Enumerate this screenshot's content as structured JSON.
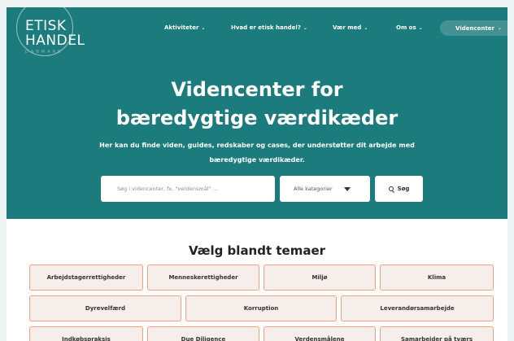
{
  "logo": {
    "line1": "ETISK",
    "line2": "HANDEL",
    "line3": "DANMARK"
  },
  "nav": {
    "items": [
      {
        "label": "Aktiviteter"
      },
      {
        "label": "Hvad er etisk handel?"
      },
      {
        "label": "Vær med"
      },
      {
        "label": "Om os"
      }
    ],
    "active": {
      "label": "Videncenter"
    },
    "chevron": "⌄"
  },
  "hero": {
    "title_line1": "Videncenter for",
    "title_line2": "bæredygtige værdikæder",
    "subtitle_line1": "Her kan du finde viden, guides, redskaber og cases, der understøtter dit arbejde med",
    "subtitle_line2": "bæredygtige værdikæder."
  },
  "search": {
    "placeholder": "Søg i videncenter, fx. \"verdensmål\" ...",
    "value": "",
    "category_selected": "Alle kategorier",
    "button_label": "Søg"
  },
  "themes": {
    "title": "Vælg blandt temaer",
    "row1": [
      "Arbejdstagerrettigheder",
      "Menneskerettigheder",
      "Miljø",
      "Klima"
    ],
    "row2": [
      "Dyrevelfærd",
      "Korruption",
      "Leverandørsamarbejde"
    ],
    "row3": [
      "Indkøbspraksis",
      "Due Diligence",
      "Verdensmålene",
      "Samarbejder på tværs"
    ]
  },
  "colors": {
    "hero_bg": "#1c7b7c",
    "tag_border": "#f2a07e",
    "tag_bg": "#f6eeea"
  }
}
